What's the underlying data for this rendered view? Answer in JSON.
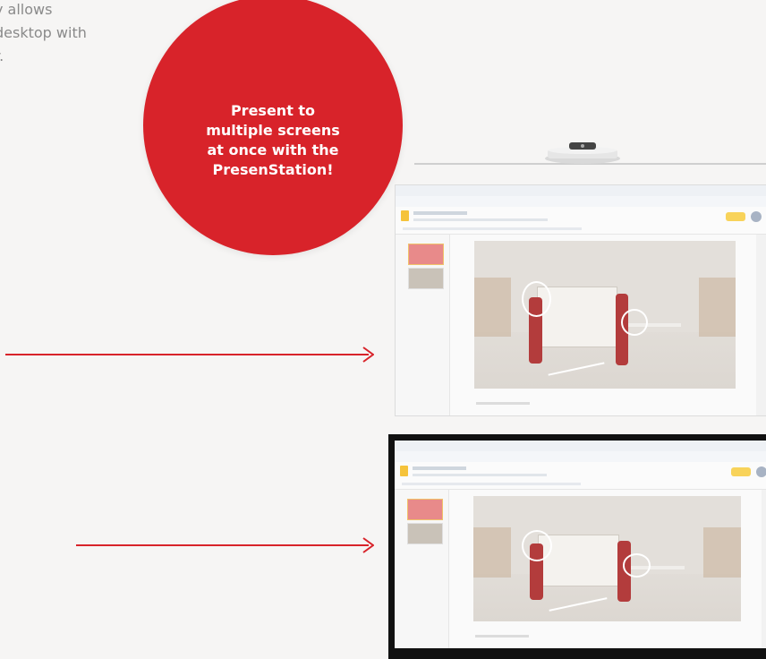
{
  "intro": {
    "lines": [
      "y allows",
      "desktop with",
      "r."
    ]
  },
  "callout": {
    "text": "Present to multiple screens at once with the PresenStation!"
  },
  "colors": {
    "brand_red": "#d8232a",
    "background": "#f6f5f4",
    "text_gray": "#8a8a8a"
  },
  "icons": {
    "device": "presenstation-device-icon",
    "arrow": "arrow-right-icon"
  },
  "screens": [
    {
      "name": "top-screen",
      "type": "projector-screen"
    },
    {
      "name": "bottom-screen",
      "type": "flat-panel-display"
    }
  ]
}
